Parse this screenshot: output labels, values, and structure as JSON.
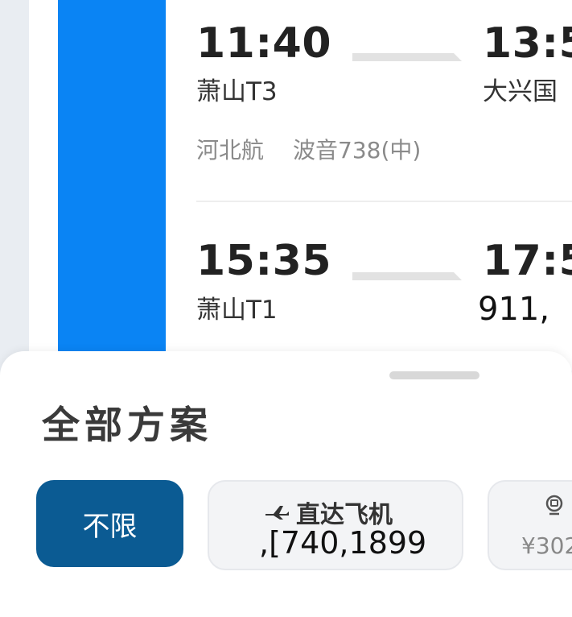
{
  "flights": [
    {
      "depart_time": "11:40",
      "depart_airport": "萧山T3",
      "arrive_time": "13:5",
      "arrive_airport": "大兴国",
      "airline": "河北航",
      "aircraft": "波音738(中)"
    },
    {
      "depart_time": "15:35",
      "depart_airport": "萧山T1",
      "arrive_time": "17:5",
      "overlay_text": "911,"
    }
  ],
  "sheet": {
    "title": "全部方案",
    "filters": [
      {
        "label": "不限",
        "selected": true
      },
      {
        "icon": "airplane-icon",
        "label": "直达飞机",
        "price": ",[740,1899"
      },
      {
        "icon": "train-icon",
        "price": "¥302"
      }
    ]
  },
  "colors": {
    "accent_blue": "#0a84f4",
    "selected_chip": "#0b5b93"
  }
}
